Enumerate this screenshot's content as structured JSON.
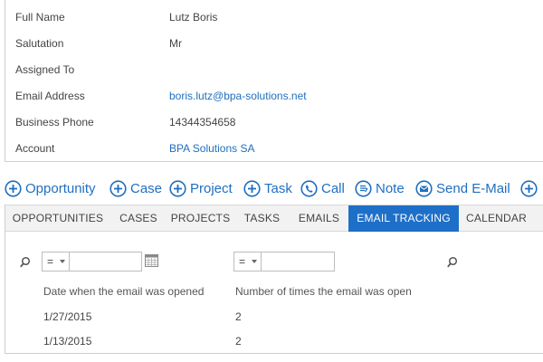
{
  "details": {
    "rows": [
      {
        "label": "Full Name",
        "value": "Lutz Boris",
        "link": false
      },
      {
        "label": "Salutation",
        "value": "Mr",
        "link": false
      },
      {
        "label": "Assigned To",
        "value": "",
        "link": false
      },
      {
        "label": "Email Address",
        "value": "boris.lutz@bpa-solutions.net",
        "link": true
      },
      {
        "label": "Business Phone",
        "value": "14344354658",
        "link": false
      },
      {
        "label": "Account",
        "value": "BPA Solutions SA",
        "link": true
      }
    ]
  },
  "actions": {
    "opportunity": "Opportunity",
    "case": "Case",
    "project": "Project",
    "task": "Task",
    "call": "Call",
    "note": "Note",
    "send_email": "Send E-Mail"
  },
  "tabs": {
    "opportunities": "OPPORTUNITIES",
    "cases": "CASES",
    "projects": "PROJECTS",
    "tasks": "TASKS",
    "emails": "EMAILS",
    "email_tracking": "EMAIL TRACKING",
    "calendar": "CALENDAR",
    "active": "EMAIL TRACKING"
  },
  "filters": {
    "date_operator": "=",
    "date_value": "",
    "count_operator": "=",
    "count_value": ""
  },
  "table": {
    "columns": [
      "Date when the email was opened",
      "Number of times the email was open"
    ],
    "rows": [
      [
        "1/27/2015",
        "2"
      ],
      [
        "1/13/2015",
        "2"
      ]
    ]
  },
  "colors": {
    "accent": "#1e6fc8",
    "link": "#1f6fbf",
    "tab_bar": "#f2f2f2"
  }
}
